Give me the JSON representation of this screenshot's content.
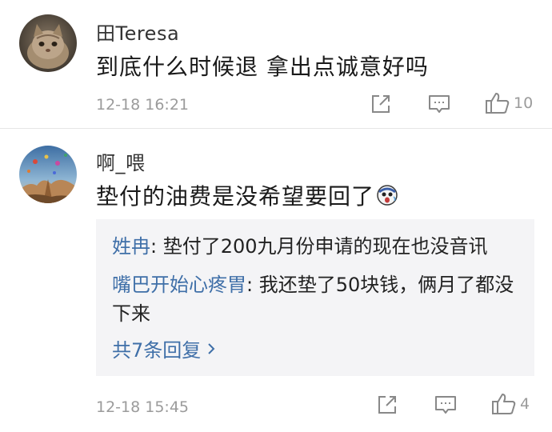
{
  "comments": [
    {
      "username": "田Teresa",
      "content": "到底什么时候退 拿出点诚意好吗",
      "timestamp": "12-18 16:21",
      "like_count": "10",
      "avatar": "cat-photo",
      "has_emoji": false
    },
    {
      "username": "啊_喂",
      "content": "垫付的油费是没希望要回了",
      "timestamp": "12-18 15:45",
      "like_count": "4",
      "avatar": "hot-air-balloon-landscape",
      "has_emoji": true,
      "emoji": "shocked-face-emoji",
      "replies": [
        {
          "name": "姓冉",
          "separator": ": ",
          "text": "垫付了200九月份申请的现在也没音讯"
        },
        {
          "name": "嘴巴开始心疼胃",
          "separator": ": ",
          "text": "我还垫了50块钱，俩月了都没下来"
        }
      ],
      "more_replies": "共7条回复",
      "more_replies_icon": "chevron-right-icon"
    }
  ],
  "actions": {
    "share_icon": "share-icon",
    "reply_icon": "comment-icon",
    "like_icon": "thumbs-up-icon"
  },
  "colors": {
    "link": "#3f6fa8",
    "meta": "#9b9b9b",
    "reply_bg": "#f4f4f6",
    "divider": "#e6e6e6"
  }
}
